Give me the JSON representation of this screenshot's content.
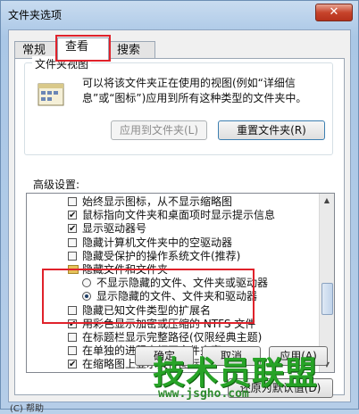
{
  "window": {
    "title": "文件夹选项",
    "close_label": "✕"
  },
  "tabs": [
    {
      "label": "常规"
    },
    {
      "label": "查看"
    },
    {
      "label": "搜索"
    }
  ],
  "folder_views": {
    "legend": "文件夹视图",
    "description": "可以将该文件夹正在使用的视图(例如“详细信息”或“图标”)应用到所有这种类型的文件夹中。",
    "apply_label": "应用到文件夹(L)",
    "reset_label": "重置文件夹(R)"
  },
  "advanced": {
    "label": "高级设置:",
    "items": [
      {
        "type": "check",
        "checked": false,
        "indent": 0,
        "text": "始终显示图标，从不显示缩略图"
      },
      {
        "type": "check",
        "checked": true,
        "indent": 0,
        "text": "鼠标指向文件夹和桌面项时显示提示信息"
      },
      {
        "type": "check",
        "checked": true,
        "indent": 0,
        "text": "显示驱动器号"
      },
      {
        "type": "check",
        "checked": false,
        "indent": 0,
        "text": "隐藏计算机文件夹中的空驱动器"
      },
      {
        "type": "check",
        "checked": false,
        "indent": 0,
        "text": "隐藏受保护的操作系统文件(推荐)"
      },
      {
        "type": "folder",
        "indent": 0,
        "text": "隐藏文件和文件夹"
      },
      {
        "type": "radio",
        "checked": false,
        "indent": 1,
        "text": "不显示隐藏的文件、文件夹或驱动器"
      },
      {
        "type": "radio",
        "checked": true,
        "indent": 1,
        "text": "显示隐藏的文件、文件夹和驱动器"
      },
      {
        "type": "check",
        "checked": false,
        "indent": 0,
        "text": "隐藏已知文件类型的扩展名"
      },
      {
        "type": "check",
        "checked": true,
        "indent": 0,
        "text": "用彩色显示加密或压缩的 NTFS 文件"
      },
      {
        "type": "check",
        "checked": false,
        "indent": 0,
        "text": "在标题栏显示完整路径(仅限经典主题)"
      },
      {
        "type": "check",
        "checked": false,
        "indent": 0,
        "text": "在单独的进程中打开文件夹窗口"
      },
      {
        "type": "check",
        "checked": true,
        "indent": 0,
        "text": "在缩略图上显示文件图标"
      }
    ]
  },
  "restore_label": "还原为默认值(D)",
  "footer": {
    "ok_label": "确定",
    "cancel_label": "取消",
    "apply_label": "应用(A)"
  },
  "watermark": {
    "text": "技术员联盟",
    "url": "www.jsgho.com"
  },
  "bottom_text": "(C) 帮助"
}
